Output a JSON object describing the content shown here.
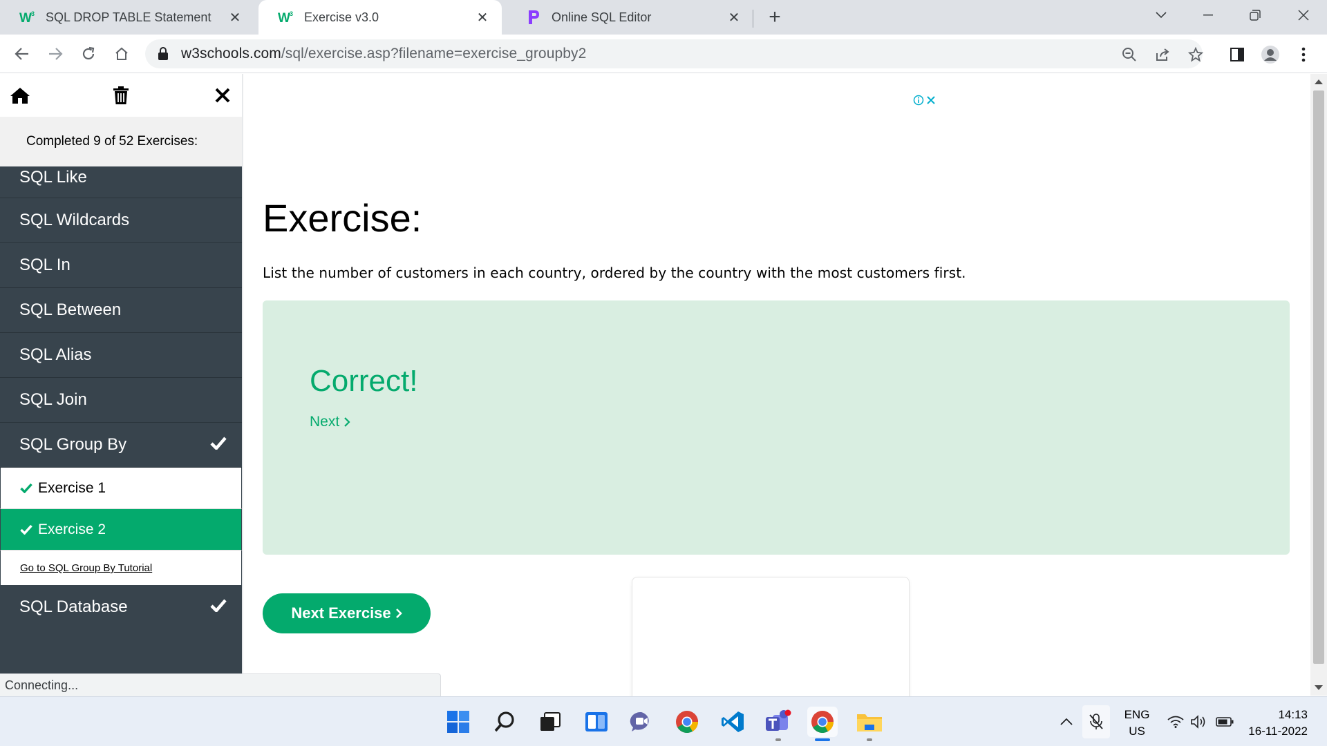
{
  "browser": {
    "tabs": [
      {
        "title": "SQL DROP TABLE Statement",
        "favicon": "w3schools-icon",
        "active": false
      },
      {
        "title": "Exercise v3.0",
        "favicon": "w3schools-icon",
        "active": true
      },
      {
        "title": "Online SQL Editor",
        "favicon": "p-logo-icon",
        "active": false
      }
    ],
    "url_domain": "w3schools.com",
    "url_path": "/sql/exercise.asp?filename=exercise_groupby2"
  },
  "sidebar": {
    "progress_text": "Completed 9 of 52 Exercises:",
    "items": [
      {
        "label": "SQL Like",
        "completed": false
      },
      {
        "label": "SQL Wildcards",
        "completed": false
      },
      {
        "label": "SQL In",
        "completed": false
      },
      {
        "label": "SQL Between",
        "completed": false
      },
      {
        "label": "SQL Alias",
        "completed": false
      },
      {
        "label": "SQL Join",
        "completed": false
      },
      {
        "label": "SQL Group By",
        "completed": true
      }
    ],
    "group_by_exercises": [
      {
        "label": "Exercise 1",
        "completed": true,
        "active": false
      },
      {
        "label": "Exercise 2",
        "completed": true,
        "active": true
      }
    ],
    "tutorial_link": "Go to SQL Group By Tutorial",
    "last_item": {
      "label": "SQL Database",
      "completed": true
    }
  },
  "main": {
    "title": "Exercise:",
    "description": "List the number of customers in each country, ordered by the country with the most customers first.",
    "result_text": "Correct!",
    "next_link": "Next",
    "next_button": "Next Exercise"
  },
  "status_bar": {
    "text": "Connecting..."
  },
  "taskbar": {
    "language": "ENG",
    "region": "US",
    "time": "14:13",
    "date": "16-11-2022"
  },
  "colors": {
    "accent_green": "#04aa6d",
    "sidebar_dark": "#38444d",
    "correct_bg": "#d9eee1"
  }
}
